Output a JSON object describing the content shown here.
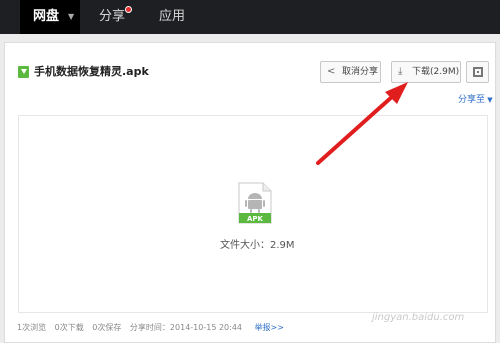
{
  "nav": {
    "items": [
      {
        "label": "网盘"
      },
      {
        "label": "分享"
      },
      {
        "label": "应用"
      }
    ]
  },
  "file": {
    "name": "手机数据恢复精灵.apk",
    "type_label": "APK",
    "size_text": "文件大小：2.9M"
  },
  "toolbar": {
    "cancel_share": "取消分享",
    "download": "下载(2.9M)",
    "share_to": "分享至"
  },
  "footer": {
    "views": "1次浏览",
    "downloads": "0次下载",
    "saves": "0次保存",
    "share_time": "分享时间：2014-10-15 20:44",
    "report": "举报>>"
  },
  "colors": {
    "topbar": "#1e1f23",
    "accent_link": "#2e6fc8",
    "apk_green": "#5ab93e",
    "arrow_red": "#e01e1e",
    "notification_dot": "#e52a2a"
  }
}
